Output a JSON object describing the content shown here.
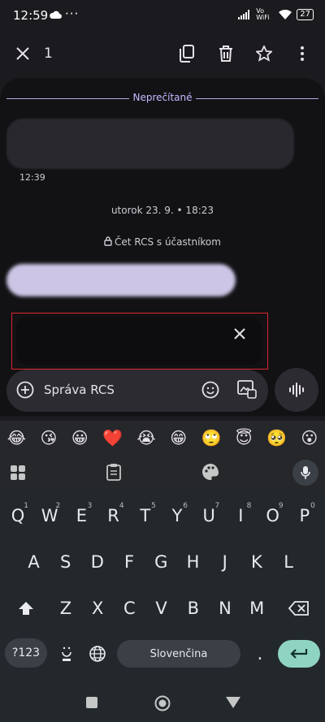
{
  "status": {
    "time": "12:59",
    "network": "Vo WiFi",
    "battery": "27"
  },
  "appbar": {
    "selected_count": "1"
  },
  "chat": {
    "unread_label": "Neprečítané",
    "message_time": "12:39",
    "datestamp": "utorok 23. 9. • 18:23",
    "rcs_note": "Čet RCS s účastníkom"
  },
  "compose": {
    "placeholder": "Správa RCS"
  },
  "emojis": [
    "😂",
    "😘",
    "😀",
    "❤️",
    "😭",
    "😁",
    "🙄",
    "😇",
    "🥺",
    "😮"
  ],
  "keyboard": {
    "row1": [
      {
        "k": "Q",
        "s": "1"
      },
      {
        "k": "W",
        "s": "2"
      },
      {
        "k": "E",
        "s": "3"
      },
      {
        "k": "R",
        "s": "4"
      },
      {
        "k": "T",
        "s": "5"
      },
      {
        "k": "Y",
        "s": "6"
      },
      {
        "k": "U",
        "s": "7"
      },
      {
        "k": "I",
        "s": "8"
      },
      {
        "k": "O",
        "s": "9"
      },
      {
        "k": "P",
        "s": "0"
      }
    ],
    "row2": [
      "A",
      "S",
      "D",
      "F",
      "G",
      "H",
      "J",
      "K",
      "L"
    ],
    "row3": [
      "Z",
      "X",
      "C",
      "V",
      "B",
      "N",
      "M"
    ],
    "symbols_label": "?123",
    "space_label": "Slovenčina",
    "period_label": "."
  },
  "colors": {
    "accent": "#8fd4c2",
    "highlight_border": "#e0252c",
    "unread_line": "#b8a8e6"
  }
}
